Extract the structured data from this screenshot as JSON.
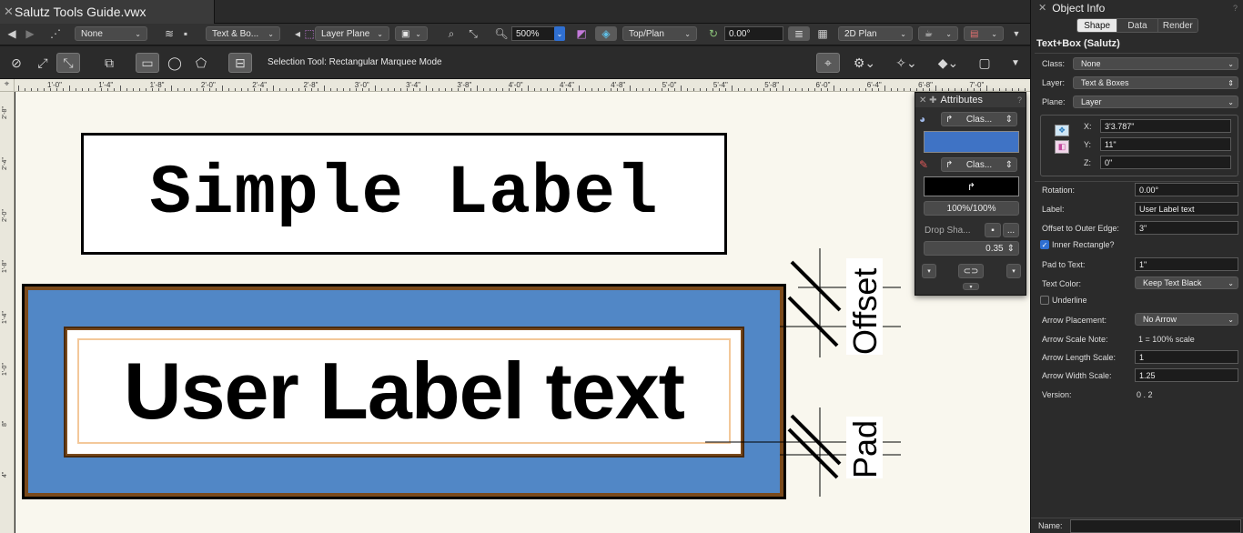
{
  "document": {
    "tab_title": "Salutz Tools Guide.vwx"
  },
  "viewbar": {
    "class_value": "None",
    "layer_value": "Text & Bo...",
    "plane_value": "Layer Plane",
    "zoom_value": "500%",
    "view_value": "Top/Plan",
    "rotation_value": "0.00°",
    "render_value": "2D Plan"
  },
  "modebar": {
    "status_text": "Selection Tool: Rectangular Marquee Mode"
  },
  "ruler": {
    "h_ticks": [
      "1'-0\"",
      "1'-4\"",
      "1'-8\"",
      "2'-0\"",
      "2'-4\"",
      "2'-8\"",
      "3'-0\"",
      "3'-4\"",
      "3'-8\"",
      "4'-0\"",
      "4'-4\"",
      "4'-8\"",
      "5'-0\"",
      "5'-4\"",
      "5'-8\"",
      "6'-0\"",
      "6'-4\"",
      "6'-8\"",
      "7'-0\""
    ],
    "v_ticks": [
      "2'-8\"",
      "2'-4\"",
      "2'-0\"",
      "1'-8\"",
      "1'-4\"",
      "1'-0\"",
      "8\"",
      "4\""
    ]
  },
  "canvas": {
    "simple_label": "Simple Label",
    "user_label": "User Label text",
    "offset_label": "Offset",
    "pad_label": "Pad",
    "colors": {
      "outer_fill": "#5187c6",
      "border": "#7a4a1c",
      "inner_rect": "#f3c89a"
    }
  },
  "attributes": {
    "title": "Attributes",
    "fill_class": "Clas...",
    "pen_class": "Clas...",
    "opacity": "100%/100%",
    "drop_shadow_label": "Drop Sha...",
    "drop_shadow_more": "...",
    "line_weight": "0.35",
    "fill_color": "#3f73c5"
  },
  "object_info": {
    "title": "Object Info",
    "tabs": [
      "Shape",
      "Data",
      "Render"
    ],
    "active_tab": "Shape",
    "object_type": "Text+Box (Salutz)",
    "class_label": "Class:",
    "class_value": "None",
    "layer_label": "Layer:",
    "layer_value": "Text & Boxes",
    "plane_label": "Plane:",
    "plane_value": "Layer",
    "x_label": "X:",
    "x_value": "3'3.787\"",
    "y_label": "Y:",
    "y_value": "11\"",
    "z_label": "Z:",
    "z_value": "0\"",
    "rotation_label": "Rotation:",
    "rotation_value": "0.00°",
    "label_label": "Label:",
    "label_value": "User Label text",
    "offset_label": "Offset to Outer Edge:",
    "offset_value": "3\"",
    "inner_rect_label": "Inner Rectangle?",
    "inner_rect_checked": "✓",
    "pad_label": "Pad to Text:",
    "pad_value": "1\"",
    "text_color_label": "Text Color:",
    "text_color_value": "Keep Text Black",
    "underline_label": "Underline",
    "arrow_placement_label": "Arrow Placement:",
    "arrow_placement_value": "No Arrow",
    "arrow_scale_note_label": "Arrow Scale Note:",
    "arrow_scale_note_value": "1 = 100% scale",
    "arrow_length_label": "Arrow Length Scale:",
    "arrow_length_value": "1",
    "arrow_width_label": "Arrow Width Scale:",
    "arrow_width_value": "1.25",
    "version_label": "Version:",
    "version_value": "0 . 2",
    "name_label": "Name:"
  }
}
